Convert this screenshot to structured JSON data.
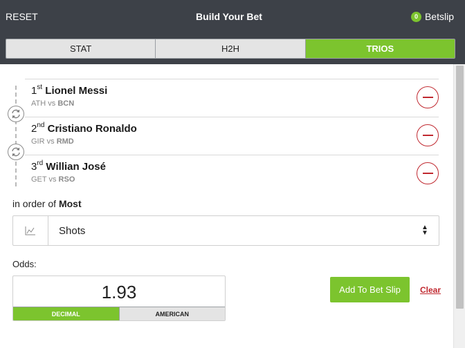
{
  "header": {
    "reset_label": "RESET",
    "title": "Build Your Bet",
    "betslip_count": "0",
    "betslip_label": "Betslip"
  },
  "tabs": [
    {
      "label": "STAT",
      "active": false
    },
    {
      "label": "H2H",
      "active": false
    },
    {
      "label": "TRIOS",
      "active": true
    }
  ],
  "picks": [
    {
      "rank": "1",
      "suffix": "st",
      "player": "Lionel Messi",
      "home": "ATH",
      "vs": "vs",
      "away": "BCN"
    },
    {
      "rank": "2",
      "suffix": "nd",
      "player": "Cristiano Ronaldo",
      "home": "GIR",
      "vs": "vs",
      "away": "RMD"
    },
    {
      "rank": "3",
      "suffix": "rd",
      "player": "Willian José",
      "home": "GET",
      "vs": "vs",
      "away": "RSO"
    }
  ],
  "order": {
    "prefix": "in order of",
    "value": "Most"
  },
  "stat_select": {
    "icon": "line-chart-icon",
    "value": "Shots"
  },
  "odds": {
    "label": "Odds:",
    "value": "1.93",
    "formats": [
      {
        "label": "DECIMAL",
        "active": true
      },
      {
        "label": "AMERICAN",
        "active": false
      }
    ]
  },
  "actions": {
    "add_label": "Add To Bet Slip",
    "clear_label": "Clear"
  },
  "colors": {
    "header_bg": "#3d4148",
    "accent_green": "#7cc42e",
    "remove_red": "#c0282f"
  }
}
